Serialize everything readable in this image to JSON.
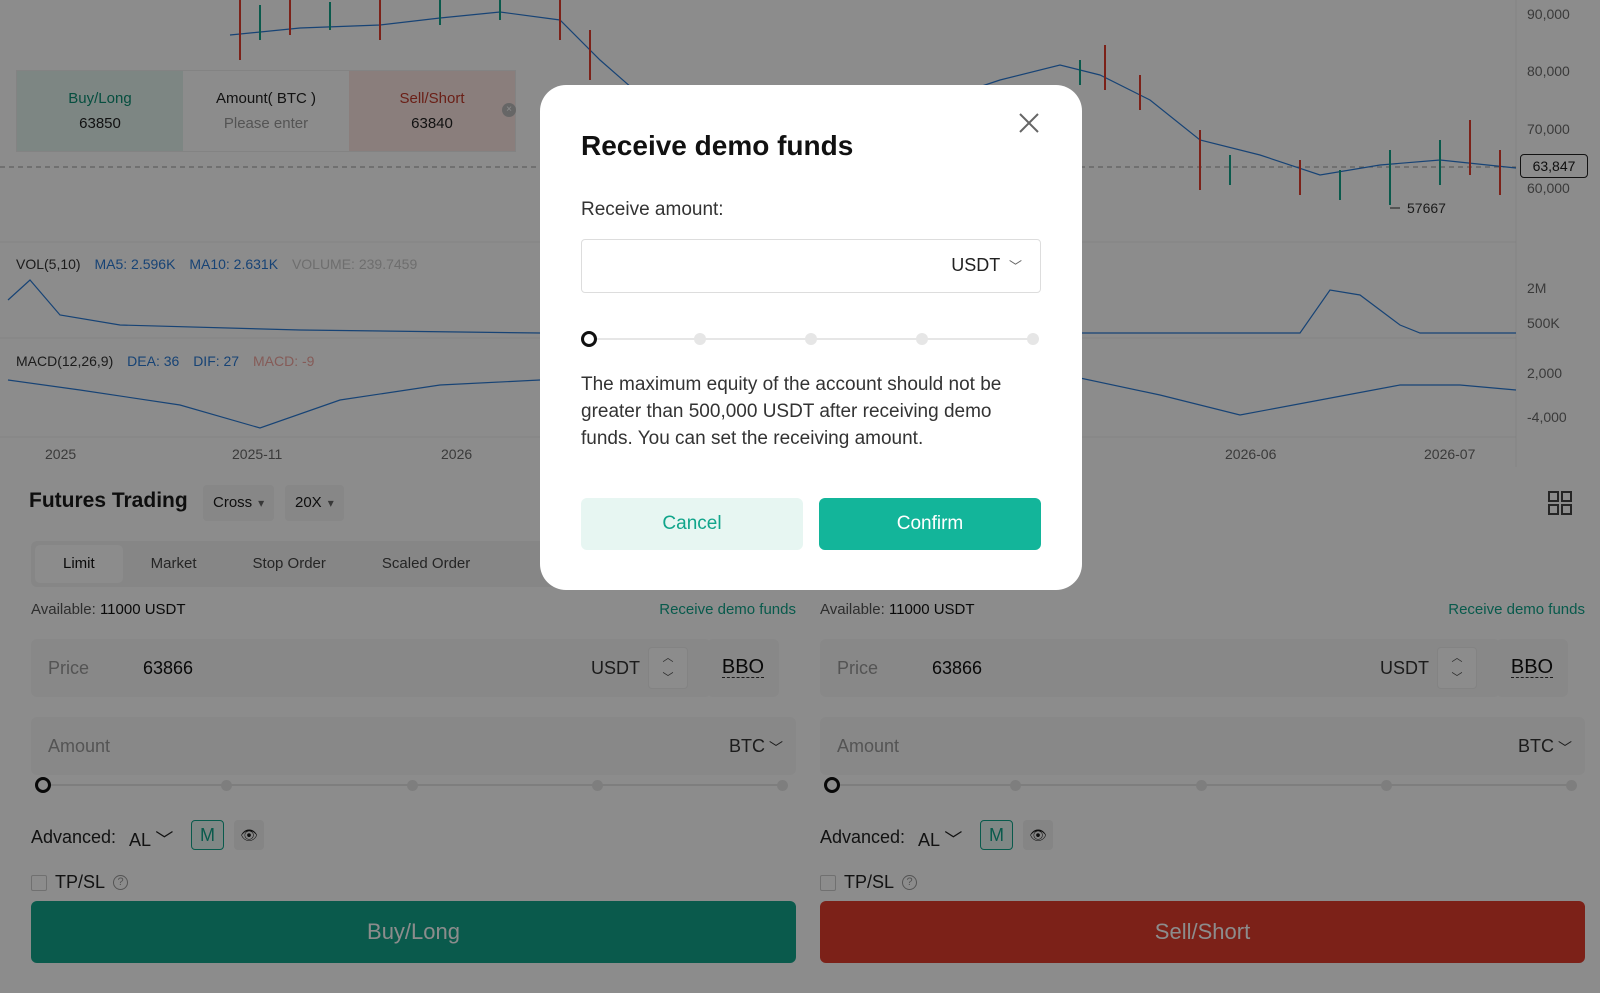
{
  "chart": {
    "price_axis": [
      "90,000",
      "80,000",
      "70,000",
      "60,000"
    ],
    "current_price": "63,847",
    "low_marker": "57667",
    "vol_axis": [
      "2M",
      "500K"
    ],
    "macd_axis": [
      "2,000",
      "-4,000"
    ],
    "date_axis": [
      "2025",
      "2025-11",
      "2026",
      "2026-06",
      "2026-07"
    ],
    "vol_indicator": {
      "name": "VOL(5,10)",
      "ma5": "MA5: 2.596K",
      "ma10": "MA10: 2.631K",
      "volume": "VOLUME: 239.7459"
    },
    "macd_indicator": {
      "name": "MACD(12,26,9)",
      "dea": "DEA: 36",
      "dif": "DIF: 27",
      "macd": "MACD: -9"
    }
  },
  "quick_order": {
    "buy_label": "Buy/Long",
    "buy_price": "63850",
    "amount_label": "Amount( BTC )",
    "amount_placeholder": "Please enter",
    "sell_label": "Sell/Short",
    "sell_price": "63840"
  },
  "trade": {
    "title": "Futures Trading",
    "margin_mode": "Cross",
    "leverage": "20X",
    "tabs": [
      "Limit",
      "Market",
      "Stop Order",
      "Scaled Order"
    ],
    "available_label": "Available:",
    "available_value": "11000 USDT",
    "receive_link": "Receive demo funds",
    "price_label": "Price",
    "price_value": "63866",
    "price_unit": "USDT",
    "bbo": "BBO",
    "amount_label": "Amount",
    "amount_unit": "BTC",
    "advanced_label": "Advanced:",
    "al": "AL",
    "m": "M",
    "tpsl": "TP/SL",
    "buy_button": "Buy/Long",
    "sell_button": "Sell/Short"
  },
  "modal": {
    "title": "Receive demo funds",
    "amount_label": "Receive amount:",
    "unit": "USDT",
    "description": "The maximum equity of the account should not be greater than 500,000 USDT after receiving demo funds. You can set the receiving amount.",
    "cancel": "Cancel",
    "confirm": "Confirm"
  }
}
